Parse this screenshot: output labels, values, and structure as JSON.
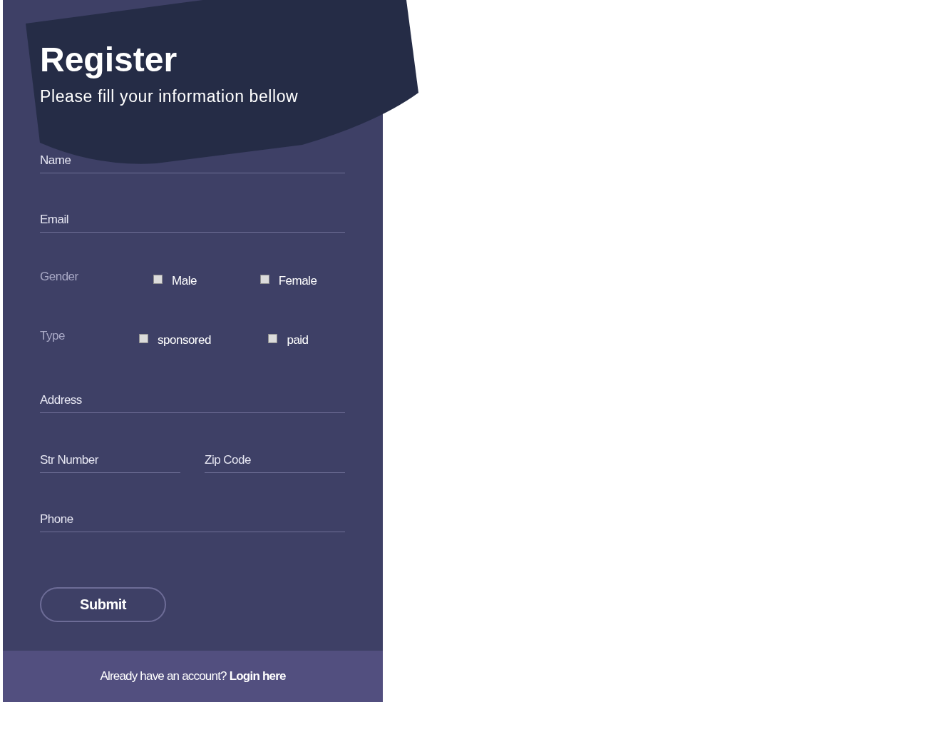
{
  "header": {
    "title": "Register",
    "subtitle": "Please fill your information bellow"
  },
  "fields_top": [
    {
      "placeholder": "Name"
    },
    {
      "placeholder": "Email"
    }
  ],
  "choice_groups": [
    {
      "label": "Gender",
      "options": [
        {
          "label": "Male",
          "checked": false
        },
        {
          "label": "Female",
          "checked": false
        }
      ]
    },
    {
      "label": "Type",
      "options": [
        {
          "label": "sponsored",
          "checked": false
        },
        {
          "label": "paid",
          "checked": false
        }
      ]
    }
  ],
  "address": {
    "placeholder": "Address"
  },
  "address_pair": [
    {
      "placeholder": "Str Number"
    },
    {
      "placeholder": "Zip Code"
    }
  ],
  "phone": {
    "placeholder": "Phone"
  },
  "submit": {
    "label": "Submit"
  },
  "footer": {
    "text": "Already have an account?",
    "link": "Login here"
  }
}
